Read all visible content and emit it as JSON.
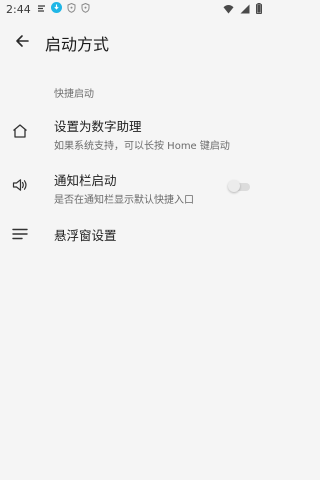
{
  "status_bar": {
    "time": "2:44",
    "left_icons": [
      "notification-icon",
      "download-icon",
      "shield-icon",
      "shield-icon"
    ],
    "right_icons": [
      "wifi-icon",
      "signal-icon",
      "battery-icon"
    ]
  },
  "app_bar": {
    "title": "启动方式"
  },
  "section": {
    "header": "快捷启动"
  },
  "items": [
    {
      "title": "设置为数字助理",
      "subtitle": "如果系统支持，可以长按 Home 键启动",
      "icon": "home-icon"
    },
    {
      "title": "通知栏启动",
      "subtitle": "是否在通知栏显示默认快捷入口",
      "icon": "speaker-icon",
      "toggle_on": false
    },
    {
      "title": "悬浮窗设置",
      "icon": "menu-icon"
    }
  ],
  "colors": {
    "background": "#f5f5f5",
    "text_primary": "#1e1e1e",
    "text_secondary": "#6b6b6b"
  }
}
